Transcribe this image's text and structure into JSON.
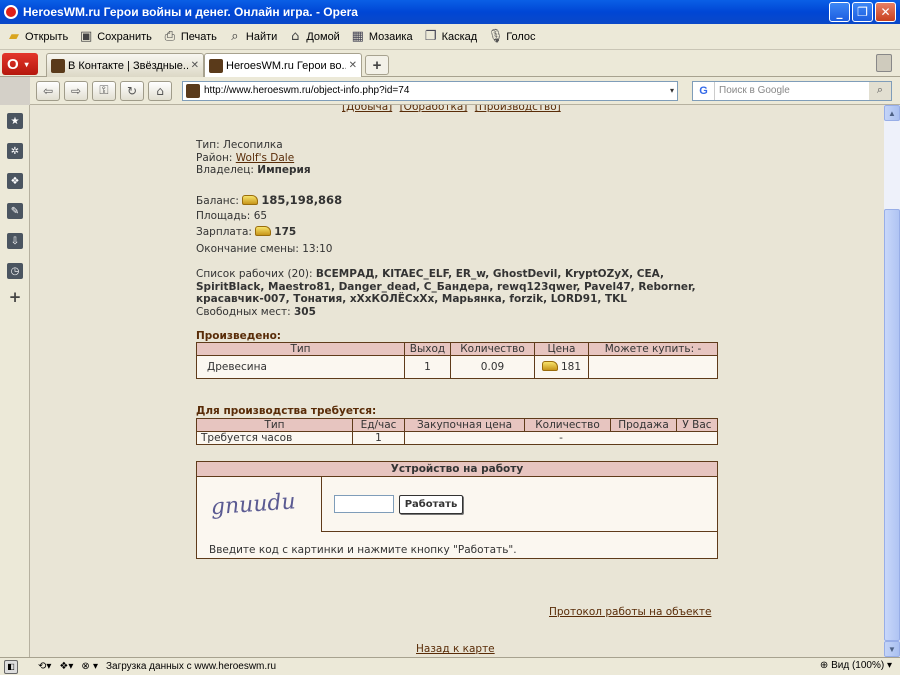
{
  "window": {
    "title": "HeroesWM.ru Герои войны и денег. Онлайн игра. - Opera",
    "min_glyph": "_",
    "max_glyph": "❐",
    "close_glyph": "✕"
  },
  "menubar": {
    "items": [
      {
        "label": "Открыть",
        "icon": "folder-icon"
      },
      {
        "label": "Сохранить",
        "icon": "save-icon"
      },
      {
        "label": "Печать",
        "icon": "print-icon"
      },
      {
        "label": "Найти",
        "icon": "search-icon"
      },
      {
        "label": "Домой",
        "icon": "home-icon"
      },
      {
        "label": "Мозаика",
        "icon": "tile-icon"
      },
      {
        "label": "Каскад",
        "icon": "cascade-icon"
      },
      {
        "label": "Голос",
        "icon": "microphone-icon"
      }
    ]
  },
  "tabs": [
    {
      "label": "В Контакте | Звёздные..."
    },
    {
      "label": "HeroesWM.ru Герои во..."
    }
  ],
  "address": {
    "url": "http://www.heroeswm.ru/object-info.php?id=74",
    "search_placeholder": "Поиск в Google",
    "search_engine": "G"
  },
  "page": {
    "top_links": [
      "[Добыча]",
      "[Обработка]",
      "[Производство]"
    ],
    "type_label": "Тип:",
    "type_value": "Лесопилка",
    "district_label": "Район:",
    "district_value": "Wolf's Dale",
    "owner_label": "Владелец:",
    "owner_value": "Империя",
    "balance_label": "Баланс:",
    "balance_value": "185,198,868",
    "area_label": "Площадь:",
    "area_value": "65",
    "salary_label": "Зарплата:",
    "salary_value": "175",
    "shift_label": "Окончание смены:",
    "shift_value": "13:10",
    "workers_label": "Список рабочих (20):",
    "workers_line1": "ВСЕМРАД, KITAEC_ELF, ER_w, GhostDevil, KryptOZyX, CEA,",
    "workers_line2": "SpiritBlack, Maestro81, Danger_dead, C_Бандера, rewq123qwer, Pavel47, Reborner,",
    "workers_line3": "красавчик-007, Тонатия, xXxКОЛЁСxXx, Марьянка, forzik, LORD91, TKL",
    "free_label": "Свободных мест:",
    "free_value": "305",
    "produced_title": "Произведено:",
    "produced_headers": [
      "Тип",
      "Выход",
      "Количество",
      "Цена",
      "Можете купить: -"
    ],
    "produced_row": {
      "type": "Древесина",
      "output": "1",
      "qty": "0.09",
      "price": "181",
      "buy": ""
    },
    "required_title": "Для производства требуется:",
    "required_headers": [
      "Тип",
      "Ед/час",
      "Закупочная цена",
      "Количество",
      "Продажа",
      "У Вас"
    ],
    "required_row": {
      "type": "Требуется часов",
      "unit": "1",
      "rest": "-"
    },
    "work_title": "Устройство на работу",
    "captcha_text": "gnuudu",
    "work_button": "Работать",
    "work_note": "Введите код с картинки и нажмите кнопку \"Работать\".",
    "protocol_link": "Протокол работы на объекте",
    "back_link": "Назад к карте"
  },
  "statusbar": {
    "text": "Загрузка данных с www.heroeswm.ru",
    "zoom": "Вид (100%)"
  },
  "colors": {
    "accent": "#0a5fe6",
    "link": "#592c08",
    "table_header": "#e7c5c0"
  }
}
